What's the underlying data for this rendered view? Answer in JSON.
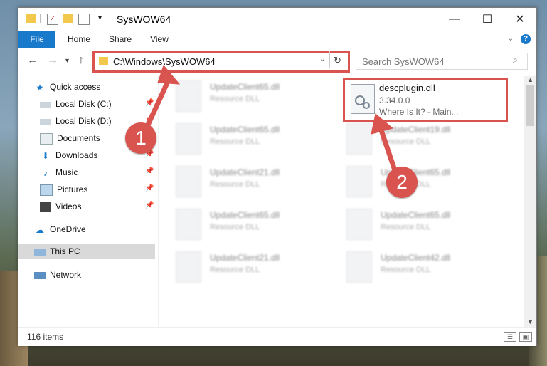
{
  "window": {
    "title": "SysWOW64"
  },
  "ribbon": {
    "tabs": [
      "File",
      "Home",
      "Share",
      "View"
    ]
  },
  "address": {
    "path": "C:\\Windows\\SysWOW64"
  },
  "search": {
    "placeholder": "Search SysWOW64"
  },
  "sidebar": {
    "items": [
      {
        "label": "Quick access",
        "icon": "star-icon"
      },
      {
        "label": "Local Disk (C:)",
        "icon": "drive-icon"
      },
      {
        "label": "Local Disk (D:)",
        "icon": "drive-icon"
      },
      {
        "label": "Documents",
        "icon": "documents-icon"
      },
      {
        "label": "Downloads",
        "icon": "download-icon"
      },
      {
        "label": "Music",
        "icon": "music-icon"
      },
      {
        "label": "Pictures",
        "icon": "pictures-icon"
      },
      {
        "label": "Videos",
        "icon": "videos-icon"
      },
      {
        "label": "OneDrive",
        "icon": "cloud-icon"
      },
      {
        "label": "This PC",
        "icon": "computer-icon"
      },
      {
        "label": "Network",
        "icon": "network-icon"
      }
    ]
  },
  "files": [
    {
      "name": "UpdateClient65.dll",
      "type": "Resource DLL"
    },
    {
      "name": "UpdateClient65.dll",
      "type": "Resource DLL"
    },
    {
      "name": "UpdateClient21.dll",
      "type": "Resource DLL"
    },
    {
      "name": "UpdateClient65.dll",
      "type": "Resource DLL"
    },
    {
      "name": "UpdateClient21.dll",
      "type": "Resource DLL"
    },
    {
      "name": "UpdateClient19.dll",
      "type": "Resource DLL"
    },
    {
      "name": "UpdateClient65.dll",
      "type": "Resource DLL"
    },
    {
      "name": "UpdateClient65.dll",
      "type": "Resource DLL"
    },
    {
      "name": "UpdateClient42.dll",
      "type": "Resource DLL"
    }
  ],
  "highlighted_file": {
    "name": "descplugin.dll",
    "version": "3.34.0.0",
    "description": "Where Is It? - Main..."
  },
  "status": {
    "item_count": "116 items"
  },
  "annotations": {
    "step1": "1",
    "step2": "2"
  },
  "colors": {
    "accent": "#1979ca",
    "highlight_red": "#d9534f"
  }
}
